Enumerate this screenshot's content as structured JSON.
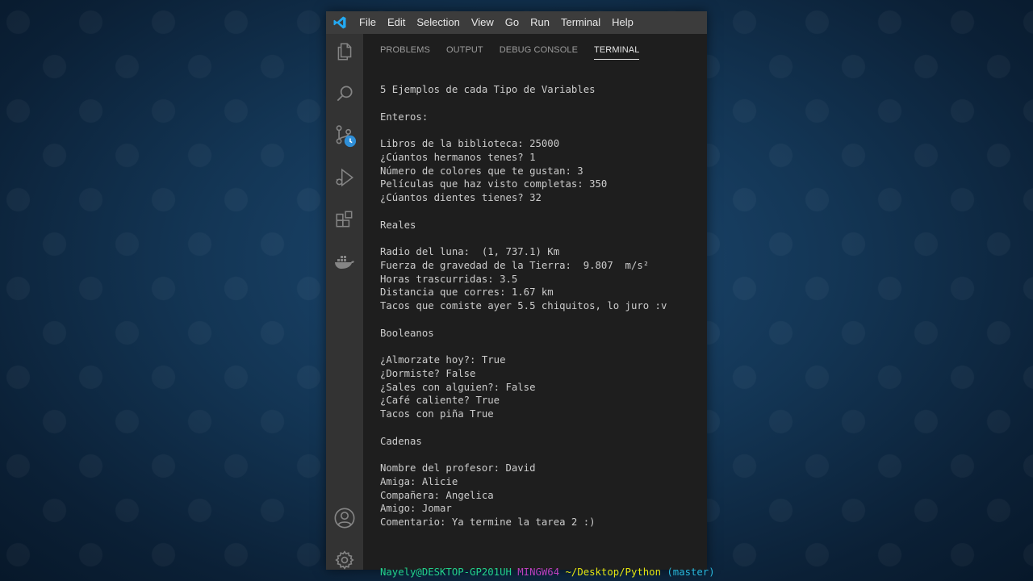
{
  "menu": [
    "File",
    "Edit",
    "Selection",
    "View",
    "Go",
    "Run",
    "Terminal",
    "Help"
  ],
  "activity_icons": [
    "explorer-icon",
    "search-icon",
    "source-control-icon",
    "run-debug-icon",
    "extensions-icon",
    "docker-icon",
    "account-icon",
    "settings-gear-icon"
  ],
  "panel_tabs": [
    {
      "label": "PROBLEMS",
      "active": false
    },
    {
      "label": "OUTPUT",
      "active": false
    },
    {
      "label": "DEBUG CONSOLE",
      "active": false
    },
    {
      "label": "TERMINAL",
      "active": true
    }
  ],
  "terminal_lines": [
    "5 Ejemplos de cada Tipo de Variables",
    "",
    "Enteros:",
    "",
    "Libros de la biblioteca: 25000",
    "¿Cúantos hermanos tenes? 1",
    "Número de colores que te gustan: 3",
    "Películas que haz visto completas: 350",
    "¿Cúantos dientes tienes? 32",
    "",
    "Reales",
    "",
    "Radio del luna:  (1, 737.1) Km",
    "Fuerza de gravedad de la Tierra:  9.807  m/s²",
    "Horas trascurridas: 3.5",
    "Distancia que corres: 1.67 km",
    "Tacos que comiste ayer 5.5 chiquitos, lo juro :v",
    "",
    "Booleanos",
    "",
    "¿Almorzate hoy?: True",
    "¿Dormiste? False",
    "¿Sales con alguien?: False",
    "¿Café caliente? True",
    "Tacos con piña True",
    "",
    "Cadenas",
    "",
    "Nombre del profesor: David",
    "Amiga: Alicie",
    "Compañera: Angelica",
    "Amigo: Jomar",
    "Comentario: Ya termine la tarea 2 :)"
  ],
  "prompt": {
    "user": "Nayely@DESKTOP-GP201UH",
    "system": "MINGW64",
    "path": "~/Desktop/Python",
    "branch": "(master)"
  },
  "colors": {
    "titlebar": "#3c3c3c",
    "activitybar": "#333333",
    "panel": "#1e1e1e",
    "vscode_blue": "#23a9f2"
  }
}
